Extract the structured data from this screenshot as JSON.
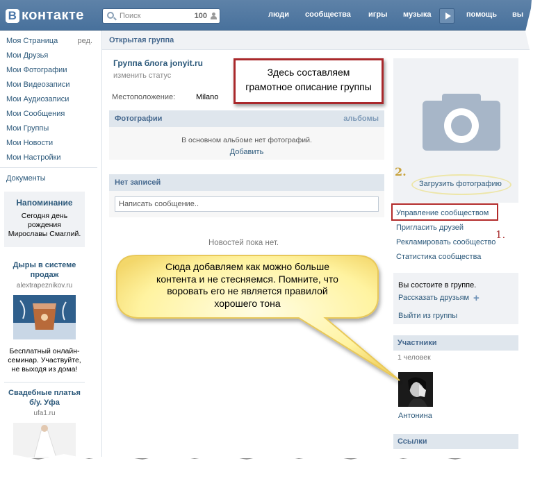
{
  "header": {
    "logo_text": "контакте",
    "logo_letter": "В",
    "search_placeholder": "Поиск",
    "search_count": "100",
    "nav": [
      "люди",
      "сообщества",
      "игры",
      "музыка",
      "помощь",
      "вы"
    ]
  },
  "sidebar": {
    "items": [
      {
        "label": "Моя Страница",
        "extra": "ред."
      },
      {
        "label": "Мои Друзья"
      },
      {
        "label": "Мои Фотографии"
      },
      {
        "label": "Мои Видеозаписи"
      },
      {
        "label": "Мои Аудиозаписи"
      },
      {
        "label": "Мои Сообщения"
      },
      {
        "label": "Мои Группы"
      },
      {
        "label": "Мои Новости"
      },
      {
        "label": "Мои Настройки"
      }
    ],
    "documents": "Документы",
    "reminder": {
      "title": "Напоминание",
      "line1": "Сегодня",
      "line1_link": "день рождения",
      "line2": "Мирославы Смаглий."
    },
    "ads": [
      {
        "title": "Дыры в системе продаж",
        "domain": "alextrapeznikov.ru",
        "text": "Бесплатный онлайн-семинар. Участвуйте, не выходя из дома!"
      },
      {
        "title": "Свадебные платья б/у. Уфа",
        "domain": "ufa1.ru"
      }
    ]
  },
  "main": {
    "section_title": "Открытая группа",
    "group_name": "Группа блога jonyit.ru",
    "status_link": "изменить статус",
    "location_label": "Местоположение:",
    "location_value": "Milano",
    "photos": {
      "title": "Фотографии",
      "right_link": "альбомы",
      "empty_text": "В основном альбоме нет фотографий.",
      "add_link": "Добавить"
    },
    "wall": {
      "title": "Нет записей",
      "input_placeholder": "Написать сообщение.."
    },
    "no_news": "Новостей пока нет."
  },
  "right": {
    "upload_photo": "Загрузить фотографию",
    "links": [
      "Управление сообществом",
      "Пригласить друзей",
      "Рекламировать сообщество",
      "Статистика сообщества"
    ],
    "membership": {
      "status": "Вы состоите в группе.",
      "tell_friends": "Рассказать друзьям",
      "leave": "Выйти из группы"
    },
    "members": {
      "title": "Участники",
      "count": "1 человек",
      "name": "Антонина"
    },
    "links_title": "Ссылки"
  },
  "annotations": {
    "box_note": "Здесь составляем грамотное описание группы",
    "box_lines": [
      "Здесь составляем",
      "грамотное описание группы"
    ],
    "bubble_lines": [
      "Сюда добавляем как можно больше",
      "контента и не стесняемся. Помните, что",
      "воровать его не является правилой",
      "хорошего тона"
    ],
    "num1": "1.",
    "num2": "2."
  },
  "colors": {
    "header_bg": "#4a76a8",
    "link": "#2b587a",
    "annotation_border": "#a9282b",
    "bubble_fill": "#fff6a8"
  }
}
